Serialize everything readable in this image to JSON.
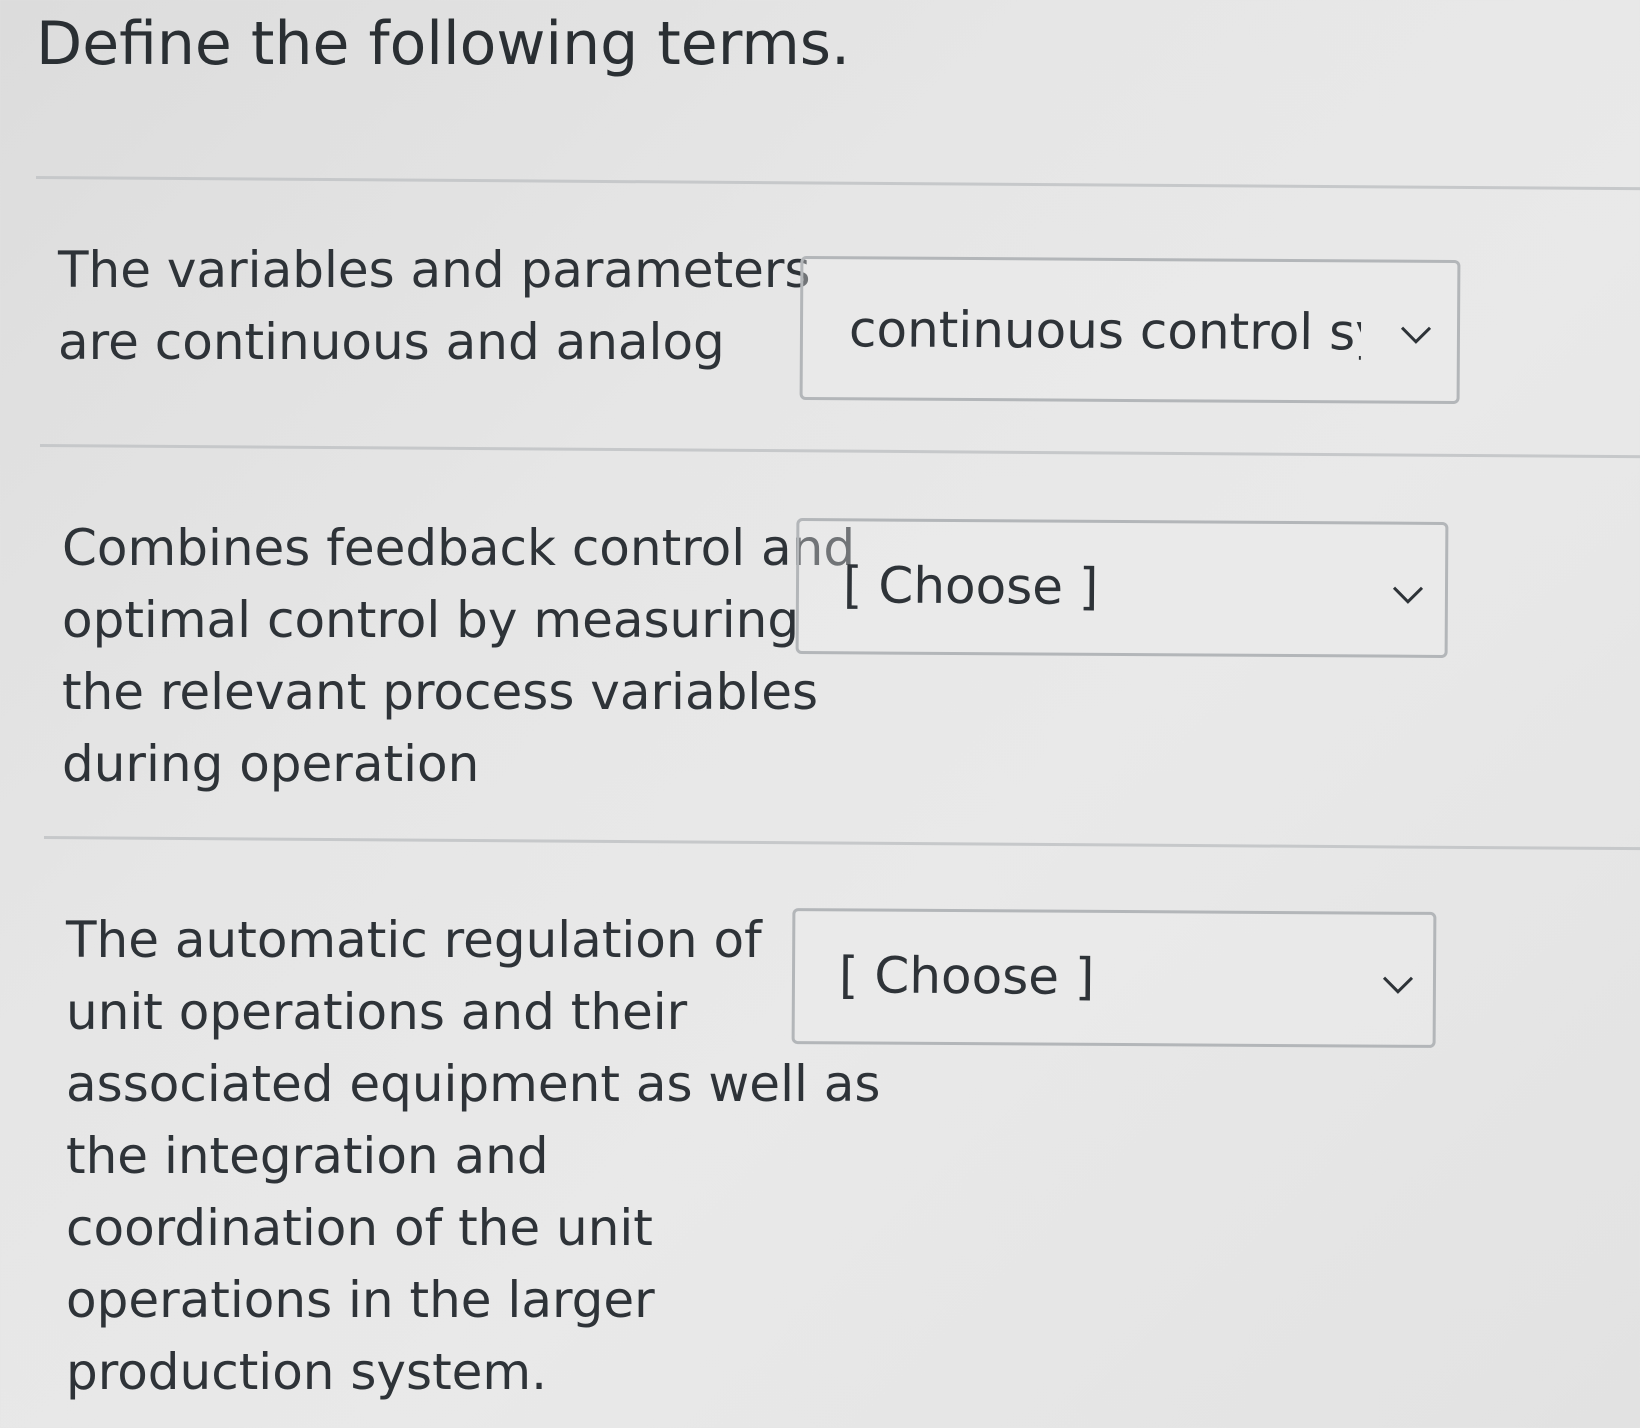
{
  "quiz": {
    "heading": "Define the following terms.",
    "questions": [
      {
        "prompt_lines": [
          "The variables and parameters",
          "are continuous and analog"
        ],
        "dropdown": {
          "selected": "continuous control sys",
          "icon": "chevron-down-icon"
        }
      },
      {
        "prompt_lines": [
          "Combines feedback control and",
          "optimal control by measuring",
          "the relevant process variables",
          "during operation"
        ],
        "dropdown": {
          "selected": "[ Choose ]",
          "icon": "chevron-down-icon"
        }
      },
      {
        "prompt_lines": [
          "The automatic regulation of",
          "unit operations and their",
          "associated equipment as well as",
          "the integration and",
          "coordination of the unit",
          "operations in the larger",
          "production system."
        ],
        "dropdown": {
          "selected": "[ Choose ]",
          "icon": "chevron-down-icon"
        }
      }
    ]
  }
}
